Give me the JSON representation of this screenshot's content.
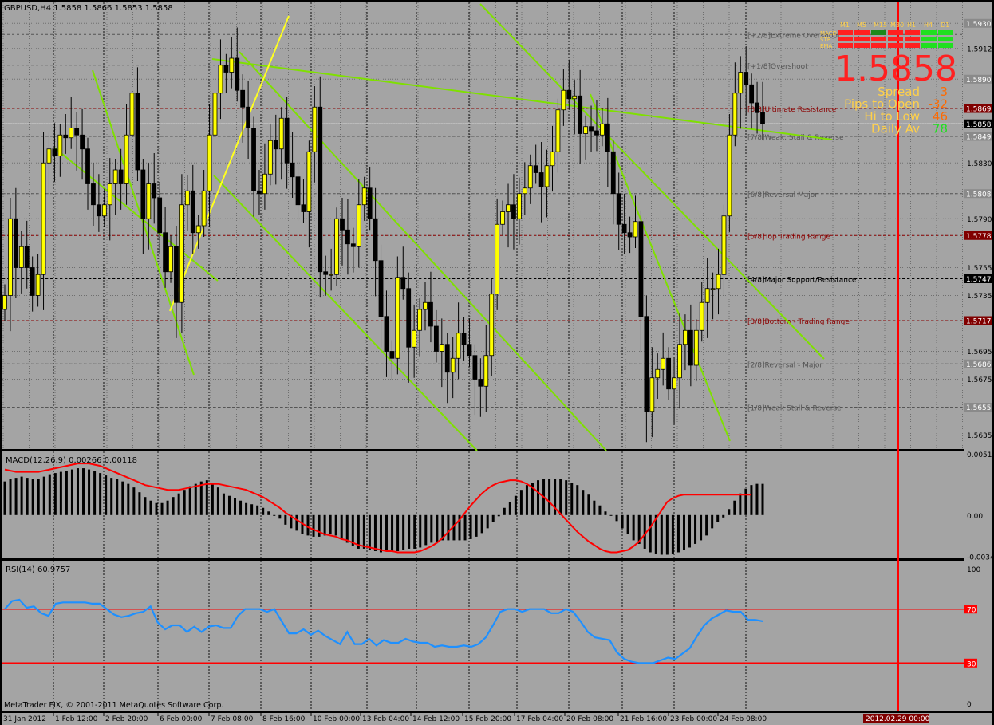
{
  "window": {
    "header": "GBPUSD,H4  1.5858 1.5866 1.5853 1.5858",
    "copyright": "MetaTrader FIX, © 2001-2011 MetaQuotes Software Corp."
  },
  "colors": {
    "background": "#a4a4a4",
    "frame": "#000000",
    "grid": "#6e6e6e",
    "bull_body": "#ffff00",
    "bear_body": "#000000",
    "wick": "#000000",
    "trendline": "#7fe000",
    "fan_line": "#ffff20",
    "macd_signal": "#ff0000",
    "rsi_line": "#1e90ff",
    "rsi_level": "#ff0000",
    "vline": "#ff0000",
    "price_highlight": "#800000"
  },
  "chart_data": [
    {
      "type": "candlestick",
      "symbol": "GBPUSD",
      "timeframe": "H4",
      "title": "GBPUSD,H4",
      "ohlc_now": {
        "open": 1.5858,
        "high": 1.5866,
        "low": 1.5853,
        "close": 1.5858
      },
      "ylim": [
        1.5625,
        1.5945
      ],
      "y_ticks": [
        1.593,
        1.5912,
        1.589,
        1.5869,
        1.5858,
        1.5849,
        1.583,
        1.5808,
        1.579,
        1.5778,
        1.5755,
        1.5747,
        1.5735,
        1.5717,
        1.5695,
        1.5686,
        1.5675,
        1.5655,
        1.5635
      ],
      "y_tick_labels": [
        "1.5930",
        "1.5912",
        "1.5890",
        "1.5869",
        "1.5858",
        "1.5849",
        "1.5830",
        "1.5808",
        "1.5790",
        "1.5778",
        "1.5755",
        "1.5747",
        "1.5735",
        "1.5717",
        "1.5695",
        "1.5686",
        "1.5675",
        "1.5655",
        "1.5635"
      ],
      "x_tick_labels": [
        "31 Jan 2012",
        "1 Feb 12:00",
        "2 Feb 20:00",
        "6 Feb 00:00",
        "7 Feb 08:00",
        "8 Feb 16:00",
        "10 Feb 00:00",
        "13 Feb 04:00",
        "14 Feb 12:00",
        "15 Feb 20:00",
        "17 Feb 04:00",
        "20 Feb 08:00",
        "21 Feb 16:00",
        "23 Feb 00:00",
        "24 Feb 08:00"
      ],
      "current_time_label": "2012.02.29 00:00",
      "series": [
        {
          "name": "GBPUSD",
          "close": [
            1.5735,
            1.579,
            1.5755,
            1.577,
            1.5755,
            1.5735,
            1.575,
            1.583,
            1.584,
            1.5835,
            1.585,
            1.5848,
            1.5855,
            1.585,
            1.584,
            1.5815,
            1.58,
            1.5792,
            1.58,
            1.5815,
            1.5825,
            1.5815,
            1.585,
            1.588,
            1.5825,
            1.579,
            1.5815,
            1.5805,
            1.578,
            1.5752,
            1.577,
            1.573,
            1.58,
            1.581,
            1.578,
            1.5785,
            1.581,
            1.585,
            1.588,
            1.59,
            1.5895,
            1.5905,
            1.5882,
            1.587,
            1.5855,
            1.581,
            1.5808,
            1.5822,
            1.5846,
            1.584,
            1.5862,
            1.583,
            1.582,
            1.58,
            1.5795,
            1.5838,
            1.587,
            1.5752,
            1.575,
            1.575,
            1.579,
            1.5782,
            1.5772,
            1.577,
            1.58,
            1.5812,
            1.579,
            1.576,
            1.572,
            1.5695,
            1.569,
            1.5748,
            1.574,
            1.5698,
            1.571,
            1.5725,
            1.573,
            1.5713,
            1.5695,
            1.57,
            1.568,
            1.569,
            1.5708,
            1.57,
            1.5692,
            1.5675,
            1.567,
            1.5692,
            1.5736,
            1.5786,
            1.5795,
            1.58,
            1.579,
            1.5808,
            1.5812,
            1.5828,
            1.5823,
            1.5813,
            1.5828,
            1.5838,
            1.5868,
            1.5882,
            1.5876,
            1.5878,
            1.5851,
            1.5856,
            1.5853,
            1.585,
            1.5858,
            1.5838,
            1.5808,
            1.5786,
            1.578,
            1.5777,
            1.5788,
            1.572,
            1.5652,
            1.5676,
            1.5682,
            1.569,
            1.5668,
            1.5676,
            1.57,
            1.571,
            1.5685,
            1.571,
            1.573,
            1.574,
            1.574,
            1.575,
            1.5792,
            1.585,
            1.588,
            1.5895,
            1.5886,
            1.5873,
            1.5866,
            1.5858
          ]
        }
      ],
      "levels": [
        {
          "label": "[+2/8]Extreme Overshoot",
          "price": 1.5922,
          "color": "#555555"
        },
        {
          "label": "[+1/8]Overshoot",
          "price": 1.59,
          "color": "#555555"
        },
        {
          "label": "[8/8]Ultimate Resistance",
          "price": 1.5869,
          "color": "#8b0000"
        },
        {
          "label": "[7/8]Weak, Stall & Reverse",
          "price": 1.5849,
          "color": "#555555"
        },
        {
          "label": "[6/8]Reversal Major",
          "price": 1.5808,
          "color": "#555555"
        },
        {
          "label": "[5/8]Top Trading Range",
          "price": 1.5778,
          "color": "#8b0000"
        },
        {
          "label": "[4/8]Major Support/Resistance",
          "price": 1.5747,
          "color": "#000000"
        },
        {
          "label": "[3/8]Bottom - Trading Range",
          "price": 1.5717,
          "color": "#8b0000"
        },
        {
          "label": "[2/8]Reversal - Major",
          "price": 1.5686,
          "color": "#555555"
        },
        {
          "label": "[1/8]Weak Stall & Reverse",
          "price": 1.5655,
          "color": "#555555"
        }
      ],
      "bid_line": 1.5858
    },
    {
      "type": "bar",
      "title": "MACD(12,26,9) 0.00266 0.00118",
      "ylim": [
        -0.0036,
        0.0053
      ],
      "y_tick_labels": [
        "0.0051",
        "0.00",
        "-0.00344"
      ],
      "y_ticks": [
        0.0051,
        0.0,
        -0.00344
      ],
      "series": [
        {
          "name": "MACD",
          "values": [
            0.0028,
            0.003,
            0.0031,
            0.0032,
            0.0031,
            0.003,
            0.003,
            0.0032,
            0.0034,
            0.0035,
            0.0036,
            0.0037,
            0.0038,
            0.0039,
            0.0039,
            0.0038,
            0.0037,
            0.0035,
            0.0033,
            0.0031,
            0.003,
            0.0028,
            0.0026,
            0.0023,
            0.0019,
            0.0015,
            0.0012,
            0.001,
            0.001,
            0.0012,
            0.0015,
            0.0018,
            0.0021,
            0.0024,
            0.0026,
            0.0028,
            0.0029,
            0.0027,
            0.0023,
            0.0018,
            0.0016,
            0.0014,
            0.0012,
            0.001,
            0.0009,
            0.0008,
            0.0006,
            0.0003,
            0.0,
            -0.0003,
            -0.0008,
            -0.0011,
            -0.0013,
            -0.0016,
            -0.0017,
            -0.0018,
            -0.0018,
            -0.0017,
            -0.0016,
            -0.0017,
            -0.002,
            -0.0023,
            -0.0026,
            -0.0028,
            -0.0028,
            -0.0029,
            -0.003,
            -0.0031,
            -0.003,
            -0.003,
            -0.003,
            -0.0029,
            -0.0028,
            -0.0028,
            -0.0027,
            -0.0025,
            -0.0023,
            -0.0022,
            -0.0021,
            -0.0021,
            -0.0021,
            -0.0021,
            -0.0021,
            -0.002,
            -0.0018,
            -0.0015,
            -0.0011,
            -0.0006,
            -0.0001,
            0.0006,
            0.0011,
            0.0016,
            0.0021,
            0.0025,
            0.0027,
            0.0029,
            0.003,
            0.003,
            0.003,
            0.003,
            0.0029,
            0.0027,
            0.0025,
            0.0021,
            0.0017,
            0.0012,
            0.0008,
            0.0003,
            0.0,
            -0.0005,
            -0.0011,
            -0.0016,
            -0.0021,
            -0.0024,
            -0.0028,
            -0.0031,
            -0.0032,
            -0.0033,
            -0.0033,
            -0.0032,
            -0.0031,
            -0.0029,
            -0.0027,
            -0.0024,
            -0.0021,
            -0.0017,
            -0.0011,
            -0.0006,
            -0.0002,
            0.0005,
            0.0012,
            0.0018,
            0.0022,
            0.0025,
            0.0026,
            0.0026
          ]
        },
        {
          "name": "Signal",
          "values": [
            0.0038,
            0.0037,
            0.0036,
            0.0036,
            0.0036,
            0.0036,
            0.0036,
            0.0037,
            0.0038,
            0.0039,
            0.004,
            0.0041,
            0.0042,
            0.0043,
            0.0043,
            0.0043,
            0.0042,
            0.0041,
            0.0039,
            0.0037,
            0.0035,
            0.0033,
            0.0031,
            0.0029,
            0.0027,
            0.0025,
            0.0024,
            0.0023,
            0.0022,
            0.0021,
            0.0021,
            0.0021,
            0.0022,
            0.0023,
            0.0024,
            0.0025,
            0.0026,
            0.0026,
            0.0026,
            0.0025,
            0.0024,
            0.0023,
            0.0022,
            0.0021,
            0.0019,
            0.0017,
            0.0015,
            0.0012,
            0.0009,
            0.0006,
            0.0002,
            -0.0001,
            -0.0004,
            -0.0007,
            -0.001,
            -0.0012,
            -0.0014,
            -0.0016,
            -0.0017,
            -0.0018,
            -0.002,
            -0.0021,
            -0.0023,
            -0.0025,
            -0.0026,
            -0.0027,
            -0.0028,
            -0.0029,
            -0.003,
            -0.003,
            -0.0031,
            -0.0031,
            -0.0031,
            -0.0031,
            -0.003,
            -0.0028,
            -0.0026,
            -0.0023,
            -0.0019,
            -0.0014,
            -0.0009,
            -0.0004,
            0.0002,
            0.0008,
            0.0013,
            0.0018,
            0.0022,
            0.0025,
            0.0027,
            0.0028,
            0.0029,
            0.0029,
            0.0028,
            0.0026,
            0.0023,
            0.0019,
            0.0015,
            0.0011,
            0.0006,
            0.0001,
            -0.0004,
            -0.0009,
            -0.0014,
            -0.0018,
            -0.0022,
            -0.0025,
            -0.0028,
            -0.003,
            -0.0031,
            -0.0031,
            -0.003,
            -0.0029,
            -0.0026,
            -0.0022,
            -0.0016,
            -0.001,
            -0.0003,
            0.0004,
            0.0011,
            0.0014,
            0.0016,
            0.0017,
            0.0017,
            0.0017,
            0.0017,
            0.0017,
            0.0017,
            0.0017,
            0.0017,
            0.0017,
            0.0017,
            0.0017,
            0.0017,
            0.0017
          ]
        }
      ]
    },
    {
      "type": "line",
      "title": "RSI(14) 60.9757",
      "ylim": [
        0,
        100
      ],
      "y_ticks": [
        100,
        70,
        30,
        0
      ],
      "y_tick_labels": [
        "100",
        "70",
        "30",
        "0"
      ],
      "levels": [
        70,
        30
      ],
      "series": [
        {
          "name": "RSI(14)",
          "values": [
            70,
            76,
            77,
            71,
            72,
            67,
            65,
            74,
            75,
            75,
            75,
            75,
            74,
            74,
            70,
            66,
            64,
            65,
            67,
            68,
            72,
            60,
            55,
            58,
            58,
            53,
            57,
            53,
            57,
            58,
            56,
            56,
            65,
            70,
            70,
            70,
            68,
            70,
            61,
            52,
            52,
            55,
            51,
            54,
            50,
            47,
            44,
            53,
            44,
            44,
            48,
            43,
            47,
            45,
            45,
            48,
            46,
            45,
            45,
            42,
            43,
            42,
            42,
            43,
            42,
            44,
            49,
            58,
            68,
            70,
            70,
            68,
            70,
            70,
            70,
            67,
            67,
            70,
            68,
            61,
            53,
            49,
            48,
            47,
            38,
            33,
            31,
            30,
            30,
            30,
            32,
            34,
            33,
            37,
            41,
            50,
            58,
            63,
            66,
            69,
            68,
            68,
            62,
            62,
            61
          ]
        }
      ]
    }
  ],
  "panel": {
    "timeframes": [
      "M1",
      "M5",
      "M15",
      "M30",
      "H1",
      "H4",
      "D1"
    ],
    "rows": [
      "MACD",
      "STR",
      "EMA"
    ],
    "cells": [
      [
        "#ff2020",
        "#ff2020",
        "#1a8a1a",
        "#ff2020",
        "#ff2020",
        "#20e020",
        "#20e020"
      ],
      [
        "#ff2020",
        "#ff2020",
        "#ff2020",
        "#ff2020",
        "#ff2020",
        "#20e020",
        "#20e020"
      ],
      [
        "#ff2020",
        "#ff2020",
        "#ff2020",
        "#ff2020",
        "#ff2020",
        "#20e020",
        "#20e020"
      ]
    ],
    "price": "1.5858",
    "stats": [
      {
        "label": "Spread",
        "value": "3",
        "color": "#ffd04a",
        "vcolor": "#ff6a00"
      },
      {
        "label": "Pips to Open",
        "value": "-32",
        "color": "#ffd04a",
        "vcolor": "#ff6a00"
      },
      {
        "label": "Hi to Low",
        "value": "46",
        "color": "#ffd04a",
        "vcolor": "#ff6a00"
      },
      {
        "label": "Daily Av",
        "value": "78",
        "color": "#ffd04a",
        "vcolor": "#20e020"
      }
    ]
  }
}
